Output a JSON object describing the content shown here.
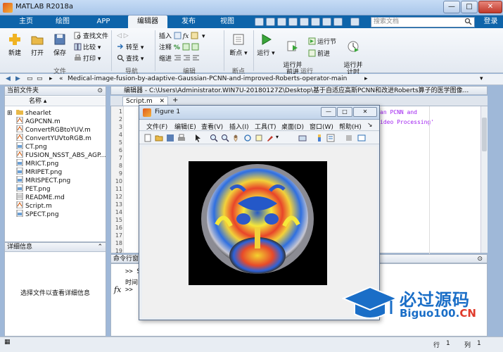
{
  "app": {
    "title": "MATLAB R2018a"
  },
  "window_buttons": {
    "min": "—",
    "max": "□",
    "close": "✕"
  },
  "tabs": [
    "主页",
    "绘图",
    "APP",
    "编辑器",
    "发布",
    "视图"
  ],
  "search": {
    "placeholder": "搜索文档",
    "login": "登录"
  },
  "ribbon": {
    "file": {
      "new": "新建",
      "open": "打开",
      "save": "保存",
      "find_files": "查找文件",
      "compare": "比较",
      "print": "打印",
      "label": "文件"
    },
    "nav": {
      "goto": "转至",
      "find": "查找",
      "label": "导航"
    },
    "edit": {
      "insert": "插入",
      "comment": "注释",
      "indent": "缩进",
      "label": "编辑"
    },
    "breakpoints": {
      "bp": "断点",
      "label": "断点"
    },
    "run": {
      "run": "运行",
      "run_advance": "运行并\n前进",
      "run_section": "运行节",
      "advance": "前进",
      "run_time": "运行并\n计时",
      "label": "运行"
    }
  },
  "address": {
    "path": "Medical-image-fusion-by-adaptive-Gaussian-PCNN-and-improved-Roberts-operator-main"
  },
  "left_panel": {
    "header": "当前文件夹",
    "column": "名称",
    "files": [
      "shearlet",
      "AGPCNN.m",
      "ConvertRGBtoYUV.m",
      "ConvertYUVtoRGB.m",
      "CT.png",
      "FUSION_NSST_ABS_AGP...",
      "MRICT.png",
      "MRIPET.png",
      "MRISPECT.png",
      "PET.png",
      "README.md",
      "Script.m",
      "SPECT.png"
    ]
  },
  "detail_panel": {
    "header": "详细信息",
    "message": "选择文件以查看详细信息"
  },
  "editor": {
    "header": "编辑器 - C:\\Users\\Administrator.WIN7U-20180127Z\\Desktop\\基于自适应高斯PCNN和改进Roberts算子的医学图像...",
    "tab": "Script.m",
    "lines": [
      "1",
      "2",
      "3",
      "4",
      "5",
      "6",
      "7",
      "8",
      "9",
      "10",
      "11",
      "12",
      "13",
      "14",
      "15",
      "16",
      "17",
      "18",
      "19"
    ],
    "code1": "an PCNN and",
    "code2": "ideo Processing'"
  },
  "command": {
    "header": "命令行窗口",
    "line1": ">> S",
    "line2": "时间",
    "prompt": ">>"
  },
  "figure": {
    "title": "Figure 1",
    "menu": [
      "文件(F)",
      "编辑(E)",
      "查看(V)",
      "插入(I)",
      "工具(T)",
      "桌面(D)",
      "窗口(W)",
      "帮助(H)"
    ]
  },
  "status": {
    "row_label": "行",
    "row": "1",
    "col_label": "列",
    "col": "1"
  },
  "watermark": {
    "name": "必过源码",
    "url_main": "Biguo100.",
    "url_tld": "CN"
  }
}
